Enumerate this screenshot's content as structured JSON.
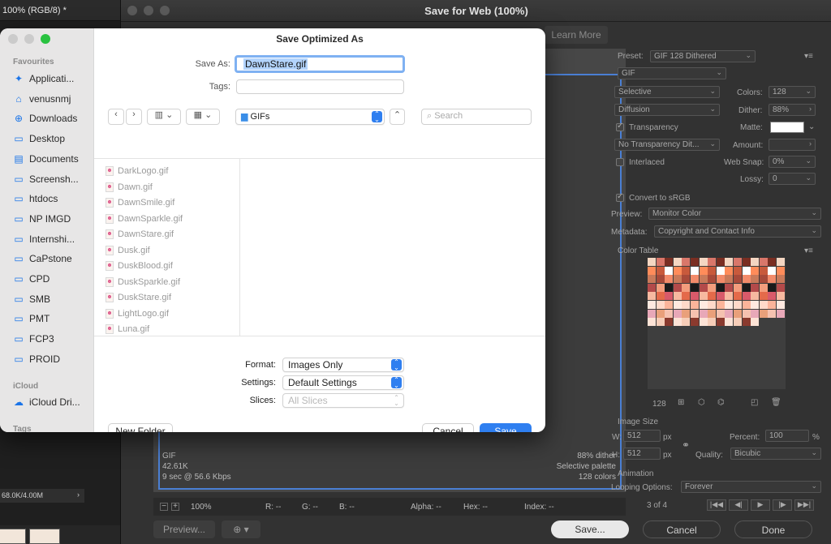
{
  "ps": {
    "doc_tab": "100% (RGB/8) *",
    "status": "68.0K/4.00M"
  },
  "sfw": {
    "title": "Save for Web (100%)",
    "learn_more": "Learn More",
    "preview_info": {
      "format": "GIF",
      "size": "42.61K",
      "time": "9 sec @ 56.6 Kbps",
      "dither": "88% dither",
      "palette": "Selective palette",
      "colors": "128 colors"
    },
    "zoom": "100%",
    "readouts": {
      "r": "R: --",
      "g": "G: --",
      "b": "B: --",
      "alpha": "Alpha: --",
      "hex": "Hex: --",
      "index": "Index: --"
    },
    "buttons": {
      "preview": "Preview...",
      "save": "Save...",
      "cancel": "Cancel",
      "done": "Done"
    },
    "panel": {
      "preset_label": "Preset:",
      "preset_value": "GIF 128 Dithered",
      "format_value": "GIF",
      "reduction_value": "Selective",
      "colors_label": "Colors:",
      "colors_value": "128",
      "dither_algo_value": "Diffusion",
      "dither_label": "Dither:",
      "dither_value": "88%",
      "transparency_label": "Transparency",
      "matte_label": "Matte:",
      "transp_dither_value": "No Transparency Dit...",
      "amount_label": "Amount:",
      "interlaced_label": "Interlaced",
      "websnap_label": "Web Snap:",
      "websnap_value": "0%",
      "lossy_label": "Lossy:",
      "lossy_value": "0",
      "convert_label": "Convert to sRGB",
      "preview_label": "Preview:",
      "preview_value": "Monitor Color",
      "metadata_label": "Metadata:",
      "metadata_value": "Copyright and Contact Info",
      "color_table_label": "Color Table",
      "color_count": "128",
      "image_size_label": "Image Size",
      "w_label": "W:",
      "w_value": "512",
      "h_label": "H:",
      "h_value": "512",
      "px": "px",
      "percent_label": "Percent:",
      "percent_value": "100",
      "percent_sign": "%",
      "quality_label": "Quality:",
      "quality_value": "Bicubic",
      "animation_label": "Animation",
      "looping_label": "Looping Options:",
      "looping_value": "Forever",
      "frame_counter": "3 of 4"
    }
  },
  "dialog": {
    "title": "Save Optimized As",
    "save_as_label": "Save As:",
    "save_as_value": "DawnStare.gif",
    "tags_label": "Tags:",
    "folder": "GIFs",
    "search_placeholder": "Search",
    "sidebar": {
      "favourites_head": "Favourites",
      "favourites": [
        {
          "label": "Applicati...",
          "icon": "applications-icon"
        },
        {
          "label": "venusnmj",
          "icon": "home-icon"
        },
        {
          "label": "Downloads",
          "icon": "downloads-icon"
        },
        {
          "label": "Desktop",
          "icon": "desktop-icon"
        },
        {
          "label": "Documents",
          "icon": "documents-icon"
        },
        {
          "label": "Screensh...",
          "icon": "folder-icon"
        },
        {
          "label": "htdocs",
          "icon": "folder-icon"
        },
        {
          "label": "NP IMGD",
          "icon": "folder-icon"
        },
        {
          "label": "Internshi...",
          "icon": "folder-icon"
        },
        {
          "label": "CaPstone",
          "icon": "folder-icon"
        },
        {
          "label": "CPD",
          "icon": "folder-icon"
        },
        {
          "label": "SMB",
          "icon": "folder-icon"
        },
        {
          "label": "PMT",
          "icon": "folder-icon"
        },
        {
          "label": "FCP3",
          "icon": "folder-icon"
        },
        {
          "label": "PROID",
          "icon": "folder-icon"
        }
      ],
      "icloud_head": "iCloud",
      "icloud_item": "iCloud Dri...",
      "tags_head": "Tags"
    },
    "files": [
      "DarkLogo.gif",
      "Dawn.gif",
      "DawnSmile.gif",
      "DawnSparkle.gif",
      "DawnStare.gif",
      "Dusk.gif",
      "DuskBlood.gif",
      "DuskSparkle.gif",
      "DuskStare.gif",
      "LightLogo.gif",
      "Luna.gif"
    ],
    "format_label": "Format:",
    "format_value": "Images Only",
    "settings_label": "Settings:",
    "settings_value": "Default Settings",
    "slices_label": "Slices:",
    "slices_value": "All Slices",
    "new_folder": "New Folder",
    "cancel": "Cancel",
    "save": "Save"
  }
}
